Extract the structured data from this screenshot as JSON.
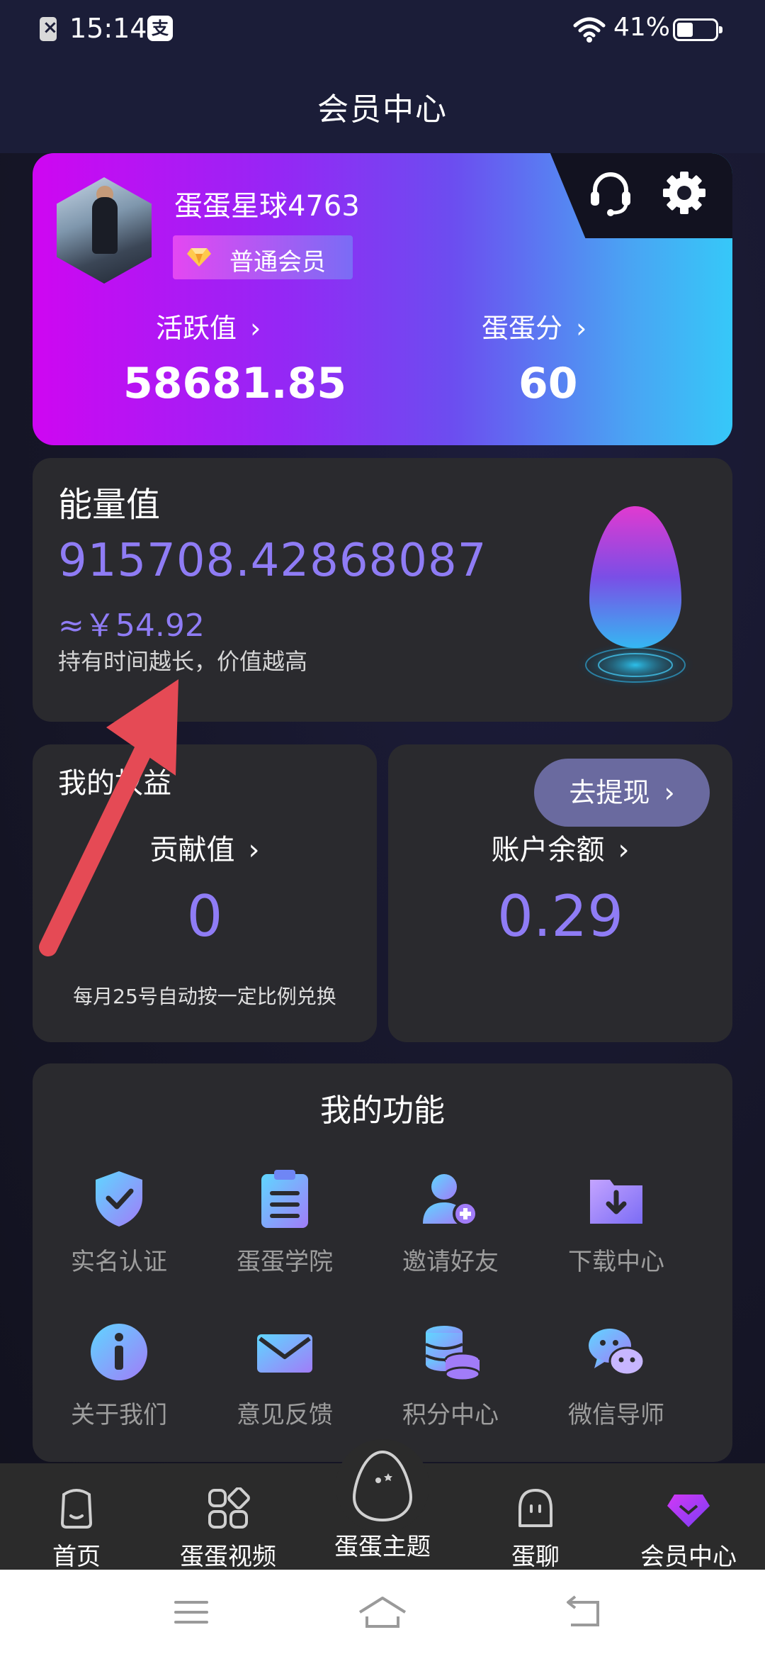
{
  "status_bar": {
    "time": "15:14",
    "battery": "41%",
    "pay_glyph": "支"
  },
  "header": {
    "title": "会员中心"
  },
  "profile": {
    "username": "蛋蛋星球4763",
    "level": "普通会员",
    "activity_label": "活跃值",
    "activity_value": "58681.85",
    "egg_score_label": "蛋蛋分",
    "egg_score_value": "60"
  },
  "energy": {
    "title": "能量值",
    "value": "915708.42868087",
    "cny": "≈￥54.92",
    "hint": "持有时间越长，价值越高"
  },
  "benefits": {
    "title": "我的权益",
    "contribution_label": "贡献值",
    "contribution_value": "0",
    "note": "每月25号自动按一定比例兑换"
  },
  "balance": {
    "withdraw_label": "去提现",
    "label": "账户余额",
    "value": "0.29"
  },
  "functions": {
    "title": "我的功能",
    "items": [
      {
        "label": "实名认证",
        "icon": "shield-check-icon"
      },
      {
        "label": "蛋蛋学院",
        "icon": "clipboard-icon"
      },
      {
        "label": "邀请好友",
        "icon": "add-user-icon"
      },
      {
        "label": "下载中心",
        "icon": "download-folder-icon"
      },
      {
        "label": "关于我们",
        "icon": "info-icon"
      },
      {
        "label": "意见反馈",
        "icon": "mail-icon"
      },
      {
        "label": "积分中心",
        "icon": "coins-icon"
      },
      {
        "label": "微信导师",
        "icon": "wechat-icon"
      }
    ]
  },
  "bottom_nav": {
    "items": [
      {
        "label": "首页",
        "icon": "home-icon"
      },
      {
        "label": "蛋蛋视频",
        "icon": "grid-icon"
      },
      {
        "label": "蛋蛋主题",
        "icon": "egg-icon"
      },
      {
        "label": "蛋聊",
        "icon": "chat-face-icon"
      },
      {
        "label": "会员中心",
        "icon": "vip-diamond-icon"
      }
    ],
    "active": "会员中心"
  },
  "colors": {
    "accent_purple": "#8f7cf5",
    "card_bg": "#2a2a2e",
    "profile_gradient_start": "#cf06f2",
    "profile_gradient_end": "#36c8f8"
  }
}
